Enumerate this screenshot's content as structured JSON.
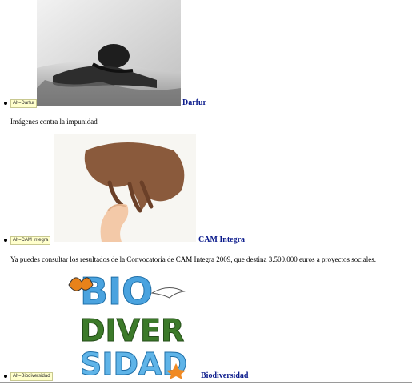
{
  "items": [
    {
      "alt_text": "Alt=Darfur",
      "title": "Darfur",
      "description": "Imágenes contra la impunidad"
    },
    {
      "alt_text": "Alt=CAM Integra",
      "title": "CAM Integra",
      "description": "Ya puedes consultar los resultados de la Convocatoria de CAM Integra 2009, que destina 3.500.000 euros a proyectos sociales."
    },
    {
      "alt_text": "Alt=Biodiversidad",
      "title": "Biodiversidad",
      "logo_text": "BIO DIVER SIDAD"
    }
  ],
  "colors": {
    "link": "#0b1b8c",
    "alt_badge_bg": "#ffffcc",
    "bio_blue": "#4aa3df",
    "bio_green": "#3c7a2a"
  }
}
